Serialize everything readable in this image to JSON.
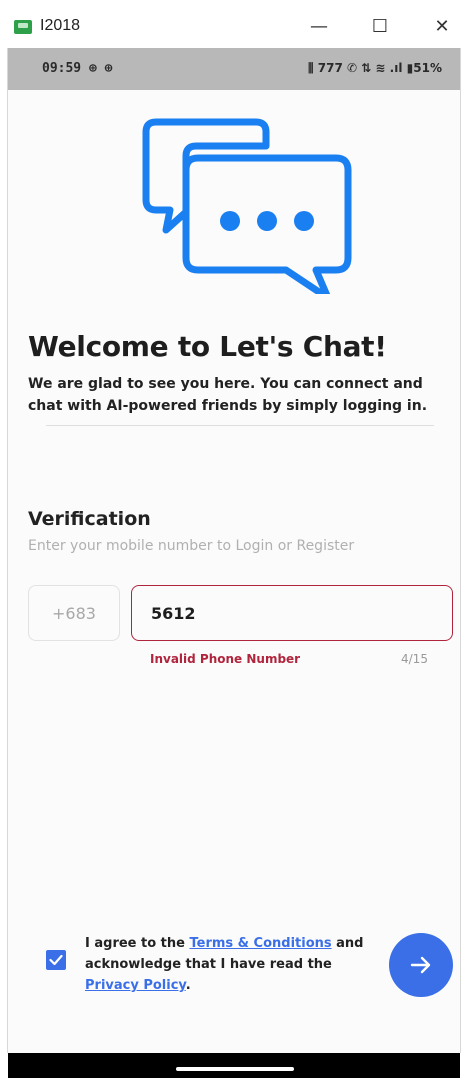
{
  "window": {
    "title": "I2018",
    "minimize_glyph": "—",
    "maximize_glyph": "☐",
    "close_glyph": "✕"
  },
  "statusbar": {
    "time": "09:59",
    "time_icons": "⊕ ⊕",
    "right_icons": "⫼ 777 ✆ ⇅ ≋ .ıl",
    "battery": "51%"
  },
  "welcome": {
    "title": "Welcome to Let's Chat!",
    "subtitle": "We are glad to see you here. You can connect and chat with AI-powered friends by simply logging in."
  },
  "verification": {
    "title": "Verification",
    "subtitle": "Enter your mobile number to Login or Register",
    "country_code": "+683",
    "phone_value": "5612",
    "error": "Invalid Phone Number",
    "counter": "4/15"
  },
  "agreement": {
    "text_1": "I agree to the ",
    "terms_link": "Terms & Conditions",
    "text_2": " and acknowledge that I have read the ",
    "privacy_link": "Privacy Policy",
    "text_3": ".",
    "checked": true
  },
  "colors": {
    "accent": "#3a6fe8",
    "logo_blue": "#1a7ff0",
    "error": "#b0253d"
  }
}
